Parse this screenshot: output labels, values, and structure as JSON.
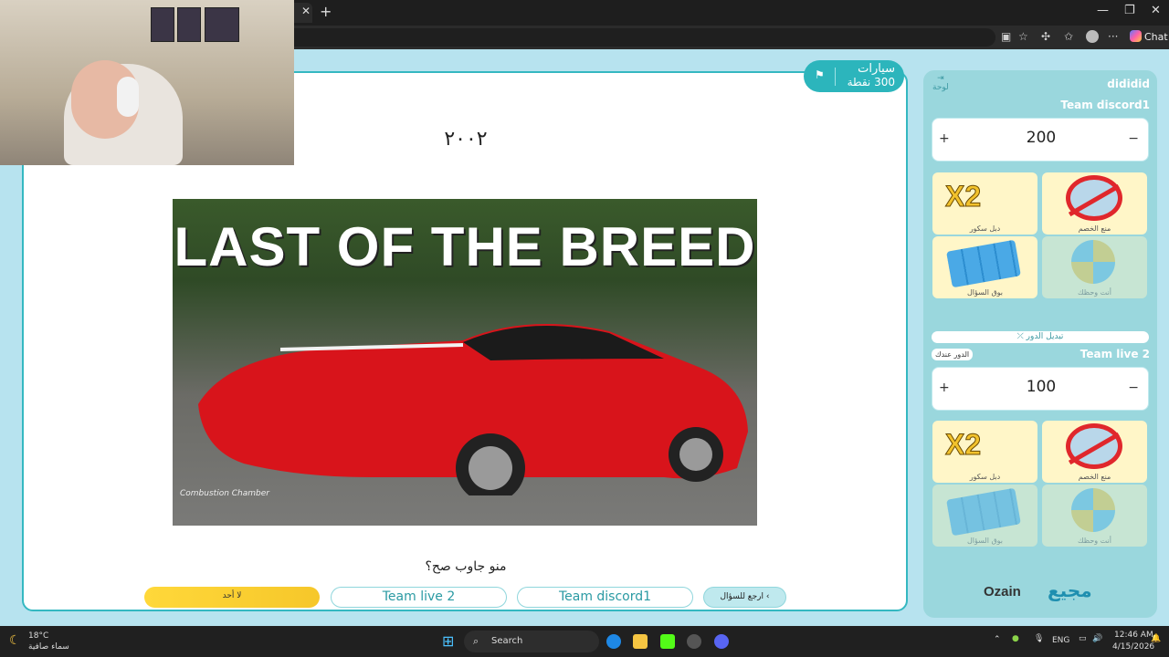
{
  "browser": {
    "tab_close": "✕",
    "new_tab": "+",
    "minimize": "—",
    "maximize": "❐",
    "close": "✕",
    "chat_label": "Chat",
    "more": "···"
  },
  "category": {
    "name": "سيارات",
    "points": "300 نقطة",
    "flag_icon": "⚑"
  },
  "question": {
    "text": "٢٠٠٢",
    "image_headline": "LAST OF THE BREED",
    "watermark": "Combustion Chamber"
  },
  "answer_prompt": "منو جاوب صح؟",
  "buttons": {
    "none": "لا أحد",
    "team2": "Team live 2",
    "team1": "Team discord1",
    "back": "ارجع للسؤال"
  },
  "sidebar": {
    "username": "dididid",
    "logout": "لوحة",
    "team1": {
      "name": "Team discord1",
      "score": "200",
      "plus": "+",
      "minus": "−"
    },
    "team2": {
      "name": "Team live 2",
      "score": "100",
      "plus": "+",
      "minus": "−"
    },
    "powerups": {
      "double": "دبل سكور",
      "block": "منع الخصم",
      "steal": "بوق السؤال",
      "wheel": "أنت وحظك",
      "x2_text": "X2"
    },
    "swap_turn": "⤫ تبديل الدور",
    "your_turn": "الدور عندك",
    "brand_zain": "Ozain",
    "brand_logo": "مجيع"
  },
  "taskbar": {
    "weather_temp": "18°C",
    "weather_desc": "سماء صافية",
    "search": "Search",
    "lang": "ENG",
    "time": "12:46 AM",
    "date": "4/15/2026"
  },
  "colors": {
    "accent": "#2cb5bc",
    "page_bg": "#b7e3ef",
    "none_button": "#ffd83a"
  }
}
